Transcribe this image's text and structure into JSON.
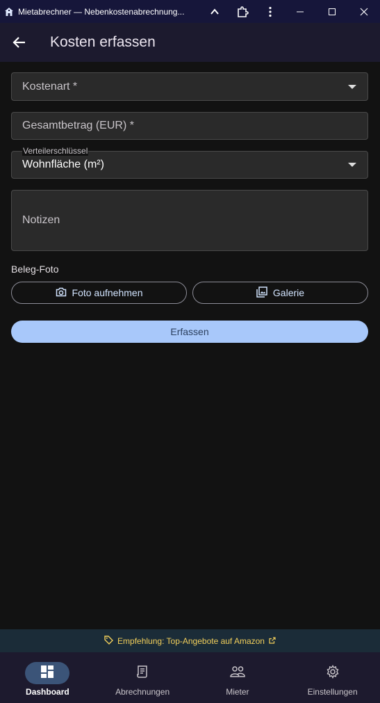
{
  "window": {
    "title": "Mietabrechner — Nebenkostenabrechnung...",
    "icons": [
      "home-icon",
      "chevron-up-icon",
      "extension-icon",
      "more-vertical-icon",
      "minimize-icon",
      "maximize-icon",
      "close-icon"
    ]
  },
  "appbar": {
    "title": "Kosten erfassen",
    "back_icon": "arrow-left-icon"
  },
  "form": {
    "cost_type": {
      "label": "Kostenart *"
    },
    "total_amount": {
      "placeholder": "Gesamtbetrag (EUR) *"
    },
    "distribution_key": {
      "label": "Verteilerschlüssel",
      "value": "Wohnfläche (m²)"
    },
    "notes": {
      "placeholder": "Notizen"
    },
    "photo_section_label": "Beleg-Foto",
    "take_photo_label": "Foto aufnehmen",
    "gallery_label": "Galerie",
    "submit_label": "Erfassen"
  },
  "promo": {
    "text": "Empfehlung: Top-Angebote auf Amazon",
    "icon": "tag-icon",
    "external_icon": "external-link-icon"
  },
  "nav": {
    "items": [
      {
        "label": "Dashboard",
        "icon": "dashboard-icon",
        "active": true
      },
      {
        "label": "Abrechnungen",
        "icon": "receipt-icon",
        "active": false
      },
      {
        "label": "Mieter",
        "icon": "people-icon",
        "active": false
      },
      {
        "label": "Einstellungen",
        "icon": "gear-icon",
        "active": false
      }
    ]
  },
  "colors": {
    "titlebar_bg": "#16163a",
    "appbar_bg": "#1c1a2e",
    "background": "#121212",
    "primary_button": "#a8c8fa",
    "promo_text": "#f2cf5b",
    "nav_active_pill": "#3b5478"
  }
}
